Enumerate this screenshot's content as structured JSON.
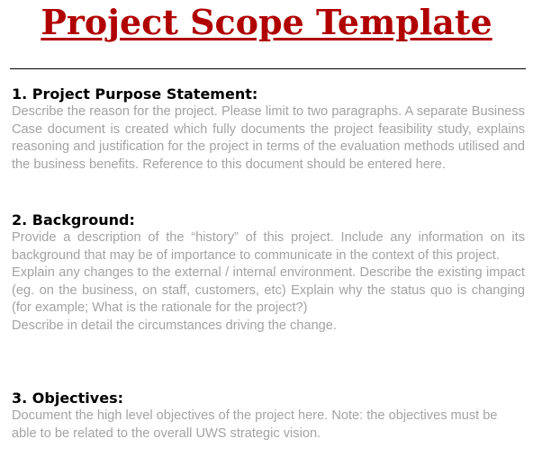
{
  "document": {
    "title": "Project Scope Template",
    "title_color": "#b00000",
    "body_text_color": "#a3a3a3"
  },
  "sections": [
    {
      "heading": "1. Project Purpose Statement:",
      "paragraphs": [
        "Describe the reason for the project. Please limit to two paragraphs. A separate Business Case document is created which fully documents the project feasibility study, explains reasoning and justification for the project in terms of the evaluation methods utilised and the business benefits.  Reference to this document should be entered here."
      ]
    },
    {
      "heading": "2. Background:",
      "paragraphs": [
        "Provide a description of the “history” of this project. Include any information on its background that may be of importance to communicate in the context of this project.",
        "Explain any changes to the external / internal environment. Describe the existing impact (eg. on the business, on staff, customers, etc) Explain why the status quo is changing (for example; What is the rationale for the project?)",
        "Describe in detail the circumstances driving the change."
      ]
    },
    {
      "heading": "3. Objectives:",
      "paragraphs": [
        "Document the high level objectives of the project here.  Note: the objectives must be able to be related to the overall UWS strategic vision."
      ]
    }
  ]
}
